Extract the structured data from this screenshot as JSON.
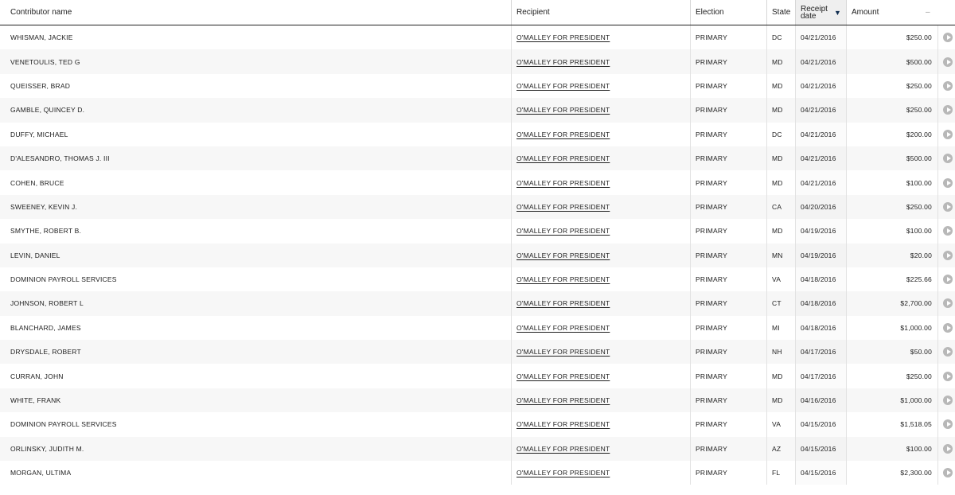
{
  "table": {
    "headers": {
      "contributor": "Contributor name",
      "recipient": "Recipient",
      "election": "Election",
      "state": "State",
      "receipt_date": "Receipt date",
      "amount": "Amount",
      "collapse": "–"
    },
    "rows": [
      {
        "name": "WHISMAN, JACKIE",
        "recipient": "O'MALLEY FOR PRESIDENT",
        "election": "PRIMARY",
        "state": "DC",
        "date": "04/21/2016",
        "amount": "$250.00"
      },
      {
        "name": "VENETOULIS, TED G",
        "recipient": "O'MALLEY FOR PRESIDENT",
        "election": "PRIMARY",
        "state": "MD",
        "date": "04/21/2016",
        "amount": "$500.00"
      },
      {
        "name": "QUEISSER, BRAD",
        "recipient": "O'MALLEY FOR PRESIDENT",
        "election": "PRIMARY",
        "state": "MD",
        "date": "04/21/2016",
        "amount": "$250.00"
      },
      {
        "name": "GAMBLE, QUINCEY D.",
        "recipient": "O'MALLEY FOR PRESIDENT",
        "election": "PRIMARY",
        "state": "MD",
        "date": "04/21/2016",
        "amount": "$250.00"
      },
      {
        "name": "DUFFY, MICHAEL",
        "recipient": "O'MALLEY FOR PRESIDENT",
        "election": "PRIMARY",
        "state": "DC",
        "date": "04/21/2016",
        "amount": "$200.00"
      },
      {
        "name": "D'ALESANDRO, THOMAS J. III",
        "recipient": "O'MALLEY FOR PRESIDENT",
        "election": "PRIMARY",
        "state": "MD",
        "date": "04/21/2016",
        "amount": "$500.00"
      },
      {
        "name": "COHEN, BRUCE",
        "recipient": "O'MALLEY FOR PRESIDENT",
        "election": "PRIMARY",
        "state": "MD",
        "date": "04/21/2016",
        "amount": "$100.00"
      },
      {
        "name": "SWEENEY, KEVIN J.",
        "recipient": "O'MALLEY FOR PRESIDENT",
        "election": "PRIMARY",
        "state": "CA",
        "date": "04/20/2016",
        "amount": "$250.00"
      },
      {
        "name": "SMYTHE, ROBERT B.",
        "recipient": "O'MALLEY FOR PRESIDENT",
        "election": "PRIMARY",
        "state": "MD",
        "date": "04/19/2016",
        "amount": "$100.00"
      },
      {
        "name": "LEVIN, DANIEL",
        "recipient": "O'MALLEY FOR PRESIDENT",
        "election": "PRIMARY",
        "state": "MN",
        "date": "04/19/2016",
        "amount": "$20.00"
      },
      {
        "name": "DOMINION PAYROLL SERVICES",
        "recipient": "O'MALLEY FOR PRESIDENT",
        "election": "PRIMARY",
        "state": "VA",
        "date": "04/18/2016",
        "amount": "$225.66"
      },
      {
        "name": "JOHNSON, ROBERT L",
        "recipient": "O'MALLEY FOR PRESIDENT",
        "election": "PRIMARY",
        "state": "CT",
        "date": "04/18/2016",
        "amount": "$2,700.00"
      },
      {
        "name": "BLANCHARD, JAMES",
        "recipient": "O'MALLEY FOR PRESIDENT",
        "election": "PRIMARY",
        "state": "MI",
        "date": "04/18/2016",
        "amount": "$1,000.00"
      },
      {
        "name": "DRYSDALE, ROBERT",
        "recipient": "O'MALLEY FOR PRESIDENT",
        "election": "PRIMARY",
        "state": "NH",
        "date": "04/17/2016",
        "amount": "$50.00"
      },
      {
        "name": "CURRAN, JOHN",
        "recipient": "O'MALLEY FOR PRESIDENT",
        "election": "PRIMARY",
        "state": "MD",
        "date": "04/17/2016",
        "amount": "$250.00"
      },
      {
        "name": "WHITE, FRANK",
        "recipient": "O'MALLEY FOR PRESIDENT",
        "election": "PRIMARY",
        "state": "MD",
        "date": "04/16/2016",
        "amount": "$1,000.00"
      },
      {
        "name": "DOMINION PAYROLL SERVICES",
        "recipient": "O'MALLEY FOR PRESIDENT",
        "election": "PRIMARY",
        "state": "VA",
        "date": "04/15/2016",
        "amount": "$1,518.05"
      },
      {
        "name": "ORLINSKY, JUDITH M.",
        "recipient": "O'MALLEY FOR PRESIDENT",
        "election": "PRIMARY",
        "state": "AZ",
        "date": "04/15/2016",
        "amount": "$100.00"
      },
      {
        "name": "MORGAN, ULTIMA",
        "recipient": "O'MALLEY FOR PRESIDENT",
        "election": "PRIMARY",
        "state": "FL",
        "date": "04/15/2016",
        "amount": "$2,300.00"
      }
    ]
  },
  "icons": {
    "sort": "sort-descending-icon",
    "row_action": "play-circle-icon"
  },
  "colors": {
    "header_border": "#212121",
    "row_alt": "#f7f7f7",
    "sort_arrow": "#112e51",
    "play_icon": "#b8b8b8"
  }
}
